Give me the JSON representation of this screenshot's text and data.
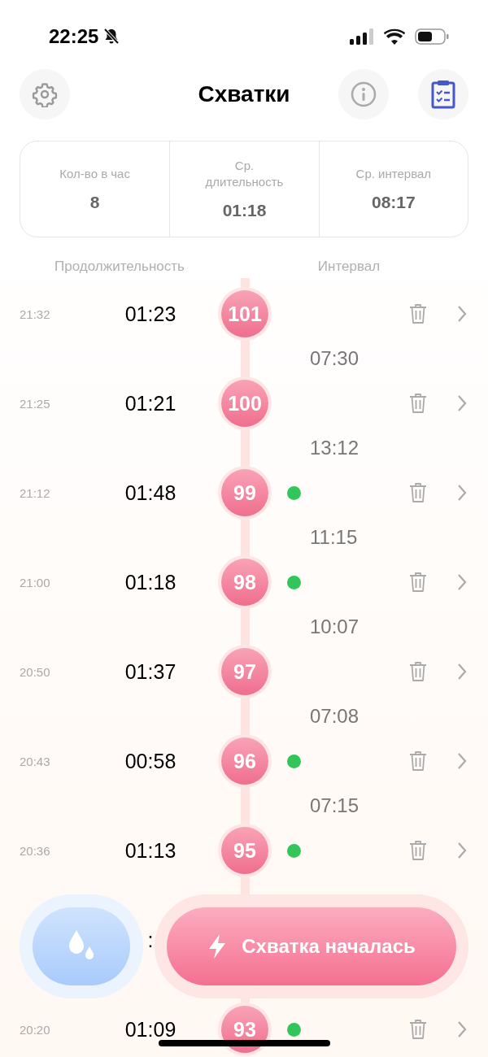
{
  "status_bar": {
    "time": "22:25"
  },
  "header": {
    "title": "Схватки"
  },
  "stats": [
    {
      "label": "Кол-во в час",
      "value": "8"
    },
    {
      "label": "Ср. длительность",
      "value": "01:18"
    },
    {
      "label": "Ср. интервал",
      "value": "08:17"
    }
  ],
  "columns": {
    "duration": "Продолжительность",
    "interval": "Интервал"
  },
  "contractions": [
    {
      "time": "21:32",
      "duration": "01:23",
      "number": "101",
      "dot": false,
      "interval": "07:30"
    },
    {
      "time": "21:25",
      "duration": "01:21",
      "number": "100",
      "dot": false,
      "interval": "13:12"
    },
    {
      "time": "21:12",
      "duration": "01:48",
      "number": "99",
      "dot": true,
      "interval": "11:15"
    },
    {
      "time": "21:00",
      "duration": "01:18",
      "number": "98",
      "dot": true,
      "interval": "10:07"
    },
    {
      "time": "20:50",
      "duration": "01:37",
      "number": "97",
      "dot": false,
      "interval": "07:08"
    },
    {
      "time": "20:43",
      "duration": "00:58",
      "number": "96",
      "dot": true,
      "interval": "07:15"
    },
    {
      "time": "20:36",
      "duration": "01:13",
      "number": "95",
      "dot": true
    },
    {
      "duration": ":",
      "dot": false
    },
    {
      "time": "20:20",
      "duration": "01:09",
      "number": "93",
      "dot": true
    }
  ],
  "start_button": {
    "label": "Схватка началась"
  }
}
